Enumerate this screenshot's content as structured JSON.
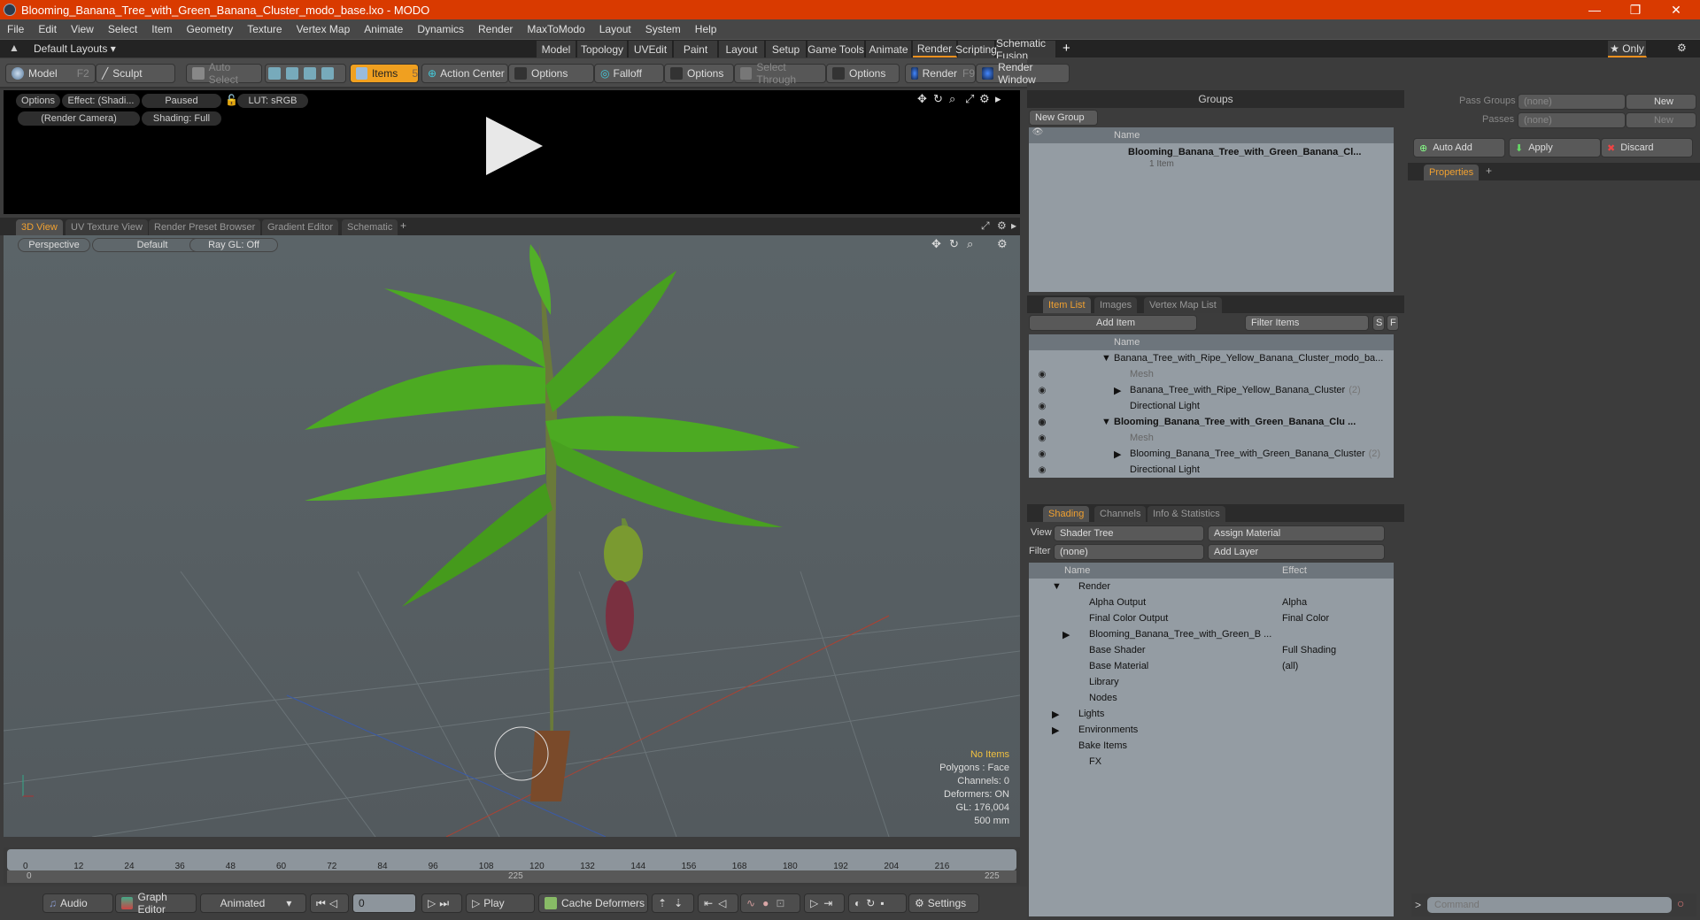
{
  "window": {
    "title": "Blooming_Banana_Tree_with_Green_Banana_Cluster_modo_base.lxo - MODO",
    "minimize": "—",
    "restore": "❐",
    "close": "✕"
  },
  "menu": [
    "File",
    "Edit",
    "View",
    "Select",
    "Item",
    "Geometry",
    "Texture",
    "Vertex Map",
    "Animate",
    "Dynamics",
    "Render",
    "MaxToModo",
    "Layout",
    "System",
    "Help"
  ],
  "layouts": {
    "label": "Default Layouts ▾",
    "tabs": [
      "Model",
      "Topology",
      "UVEdit",
      "Paint",
      "Layout",
      "Setup",
      "Game Tools",
      "Animate",
      "Render",
      "Scripting",
      "Schematic Fusion"
    ],
    "active": "Render",
    "add": "+",
    "only": "★ Only"
  },
  "toolbar": {
    "model": "Model",
    "model_key": "F2",
    "sculpt": "Sculpt",
    "auto_select": "Auto Select",
    "items": "Items",
    "items_count": "5",
    "action_center": "Action Center",
    "options1": "Options",
    "falloff": "Falloff",
    "options2": "Options",
    "select_through": "Select Through",
    "options3": "Options",
    "render": "Render",
    "render_key": "F9",
    "render_window": "Render Window"
  },
  "render_preview": {
    "options": "Options",
    "effect": "Effect: (Shadi...",
    "paused": "Paused",
    "lut": "LUT: sRGB",
    "camera": "(Render Camera)",
    "shading": "Shading: Full"
  },
  "viewport_tabs": [
    "3D View",
    "UV Texture View",
    "Render Preset Browser",
    "Gradient Editor",
    "Schematic"
  ],
  "viewport": {
    "projection": "Perspective",
    "style": "Default",
    "raygl": "Ray GL: Off",
    "hud": {
      "no_items": "No Items",
      "polygons": "Polygons : Face",
      "channels": "Channels: 0",
      "deformers": "Deformers: ON",
      "gl": "GL: 176,004",
      "scale": "500 mm"
    }
  },
  "timeline": {
    "ticks": [
      "0",
      "12",
      "24",
      "36",
      "48",
      "60",
      "72",
      "84",
      "96",
      "108",
      "120",
      "132",
      "144",
      "156",
      "168",
      "180",
      "192",
      "204",
      "216"
    ],
    "range_start": "0",
    "range_mid": "225",
    "range_end": "225",
    "current_frame": "0"
  },
  "bottombar": {
    "audio": "Audio",
    "graph_editor": "Graph Editor",
    "animated": "Animated",
    "frame": "0",
    "play": "Play",
    "cache_deformers": "Cache Deformers",
    "settings": "Settings"
  },
  "groups": {
    "title": "Groups",
    "new_group": "New Group",
    "col_name": "Name",
    "rows": [
      {
        "name": "Blooming_Banana_Tree_with_Green_Banana_Cl...",
        "sub": "1 Item"
      }
    ]
  },
  "item_list": {
    "tabs": [
      "Item List",
      "Images",
      "Vertex Map List"
    ],
    "add_item": "Add Item",
    "filter": "Filter Items",
    "s": "S",
    "f": "F",
    "col_name": "Name",
    "rows": [
      {
        "name": "Banana_Tree_with_Ripe_Yellow_Banana_Cluster_modo_ba...",
        "indent": 0,
        "bold": false,
        "dim": false,
        "arrow": "▼"
      },
      {
        "name": "Mesh",
        "indent": 1,
        "dim": true,
        "arrow": ""
      },
      {
        "name": "Banana_Tree_with_Ripe_Yellow_Banana_Cluster",
        "count": "(2)",
        "indent": 1,
        "arrow": "▶"
      },
      {
        "name": "Directional Light",
        "indent": 1,
        "arrow": ""
      },
      {
        "name": "Blooming_Banana_Tree_with_Green_Banana_Clu ...",
        "indent": 0,
        "bold": true,
        "arrow": "▼"
      },
      {
        "name": "Mesh",
        "indent": 1,
        "dim": true,
        "arrow": ""
      },
      {
        "name": "Blooming_Banana_Tree_with_Green_Banana_Cluster",
        "count": "(2)",
        "indent": 1,
        "arrow": "▶"
      },
      {
        "name": "Directional Light",
        "indent": 1,
        "arrow": ""
      }
    ]
  },
  "shading": {
    "tabs": [
      "Shading",
      "Channels",
      "Info & Statistics"
    ],
    "view_label": "View",
    "view": "Shader Tree",
    "assign": "Assign Material",
    "filter_label": "Filter",
    "filter": "(none)",
    "add_layer": "Add Layer",
    "col_name": "Name",
    "col_effect": "Effect",
    "rows": [
      {
        "name": "Render",
        "effect": "",
        "indent": 0,
        "arrow": "▼"
      },
      {
        "name": "Alpha Output",
        "effect": "Alpha",
        "indent": 1
      },
      {
        "name": "Final Color Output",
        "effect": "Final Color",
        "indent": 1
      },
      {
        "name": "Blooming_Banana_Tree_with_Green_B ...",
        "effect": "",
        "indent": 1,
        "arrow": "▶"
      },
      {
        "name": "Base Shader",
        "effect": "Full Shading",
        "indent": 1
      },
      {
        "name": "Base Material",
        "effect": "(all)",
        "indent": 1
      },
      {
        "name": "Library",
        "effect": "",
        "indent": 1
      },
      {
        "name": "Nodes",
        "effect": "",
        "indent": 1
      },
      {
        "name": "Lights",
        "effect": "",
        "indent": 0,
        "arrow": "▶"
      },
      {
        "name": "Environments",
        "effect": "",
        "indent": 0,
        "arrow": "▶"
      },
      {
        "name": "Bake Items",
        "effect": "",
        "indent": 0
      },
      {
        "name": "FX",
        "effect": "",
        "indent": 1
      }
    ]
  },
  "passes": {
    "pass_groups_label": "Pass Groups",
    "pass_groups": "(none)",
    "passes_label": "Passes",
    "passes": "(none)",
    "new": "New",
    "auto_add": "Auto Add",
    "apply": "Apply",
    "discard": "Discard"
  },
  "properties": {
    "tab": "Properties"
  },
  "command": {
    "prompt": ">",
    "placeholder": "Command"
  },
  "colors": {
    "accent": "#f0a020",
    "title_bar": "#d93a00"
  }
}
